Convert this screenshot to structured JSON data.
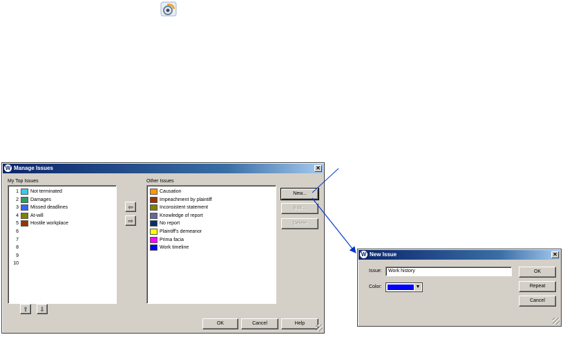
{
  "manage_dialog": {
    "title": "Manage Issues",
    "close_glyph": "✕",
    "logo_glyph": "W",
    "top_label": "My Top Issues",
    "other_label": "Other Issues",
    "top_issues": [
      {
        "num": "1",
        "label": "Not terminated",
        "color": "#33ccee"
      },
      {
        "num": "2",
        "label": "Damages",
        "color": "#339966"
      },
      {
        "num": "3",
        "label": "Missed deadlines",
        "color": "#3366ff"
      },
      {
        "num": "4",
        "label": "At-will",
        "color": "#808000"
      },
      {
        "num": "5",
        "label": "Hostile workplace",
        "color": "#993300"
      },
      {
        "num": "6",
        "label": "",
        "color": ""
      },
      {
        "num": "7",
        "label": "",
        "color": ""
      },
      {
        "num": "8",
        "label": "",
        "color": ""
      },
      {
        "num": "9",
        "label": "",
        "color": ""
      },
      {
        "num": "10",
        "label": "",
        "color": ""
      }
    ],
    "other_issues": [
      {
        "label": "Causation",
        "color": "#ff9900"
      },
      {
        "label": "Impeachment by plaintiff",
        "color": "#993300"
      },
      {
        "label": "Inconsistent statement",
        "color": "#808000"
      },
      {
        "label": "Knowledge of report",
        "color": "#666699"
      },
      {
        "label": "No report",
        "color": "#003366"
      },
      {
        "label": "Plaintiff's demeanor",
        "color": "#ffff00"
      },
      {
        "label": "Prima facia",
        "color": "#ff00ff"
      },
      {
        "label": "Work timeline",
        "color": "#0000ff"
      }
    ],
    "buttons": {
      "new": "New...",
      "edit": "Edit...",
      "delete": "Delete",
      "ok": "OK",
      "cancel": "Cancel",
      "help": "Help",
      "move_left": "⇦",
      "move_right": "⇨",
      "move_up": "⇧",
      "move_down": "⇩"
    }
  },
  "new_issue_dialog": {
    "title": "New Issue",
    "close_glyph": "✕",
    "logo_glyph": "W",
    "issue_label": "Issue:",
    "issue_value": "Work history",
    "color_label": "Color:",
    "color_value": "#0000ff",
    "buttons": {
      "ok": "OK",
      "repeat": "Repeat",
      "cancel": "Cancel"
    }
  },
  "colors": {
    "window": "#d4d0c8",
    "title_start": "#0a246a",
    "callout": "#0033cc"
  },
  "icons": [
    "camera-lens-icon",
    "w-logo-icon",
    "close-icon",
    "arrow-left-icon",
    "arrow-right-icon",
    "arrow-up-icon",
    "arrow-down-icon",
    "dropdown-arrow-icon",
    "resize-grip-icon"
  ]
}
